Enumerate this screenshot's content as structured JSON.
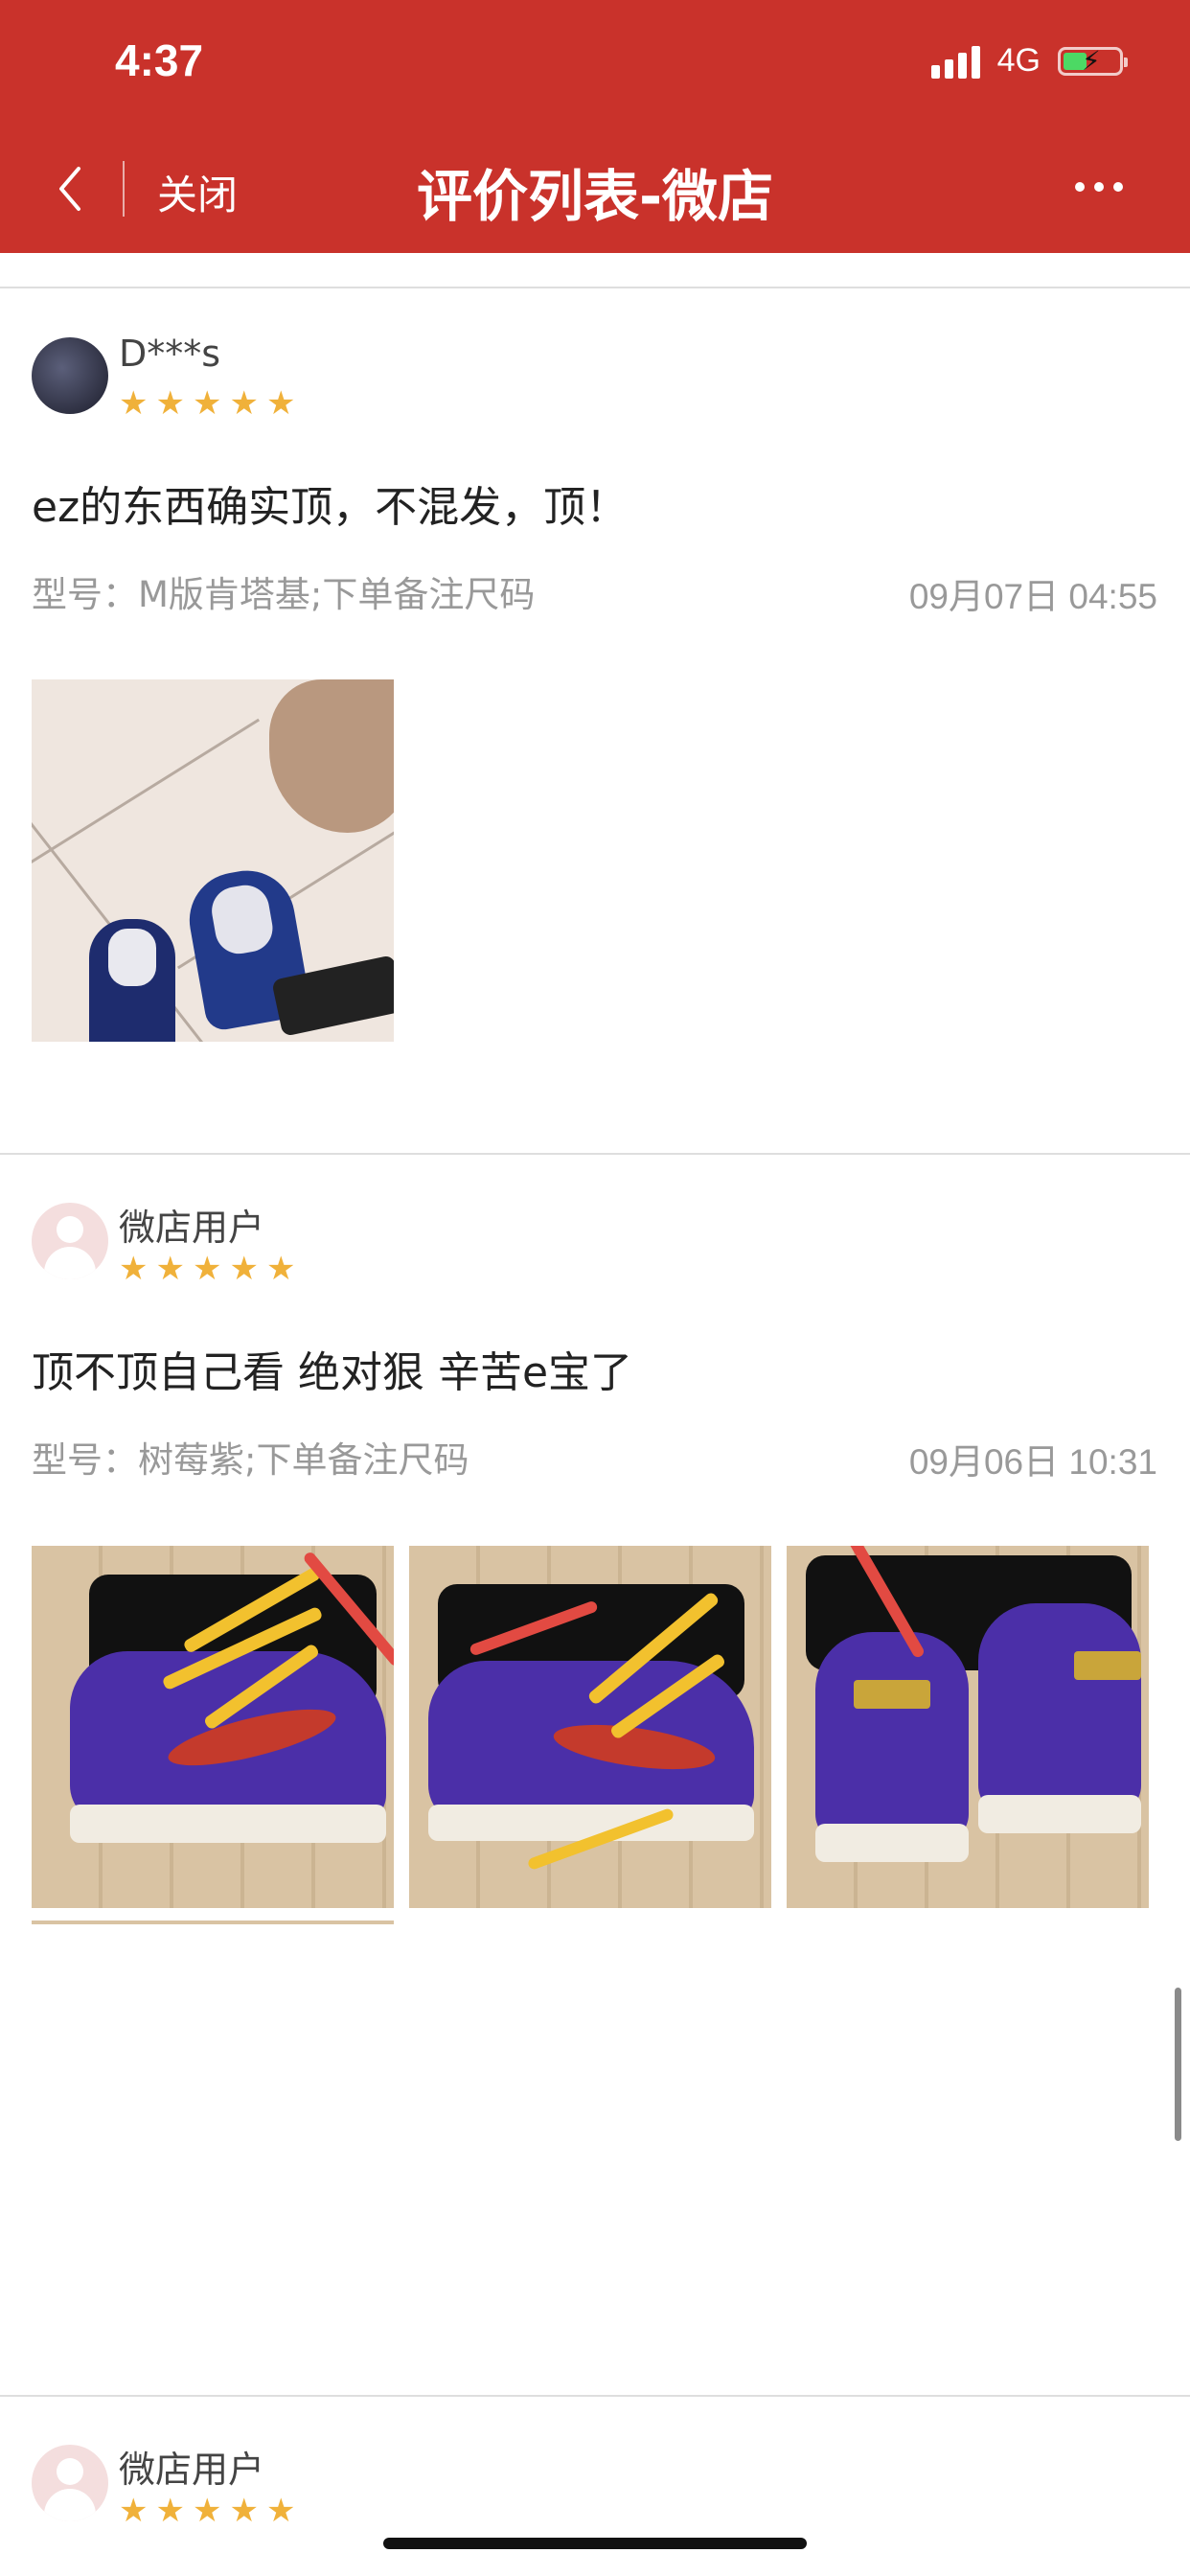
{
  "status_bar": {
    "time": "4:37",
    "network": "4G",
    "battery_icon": "battery-charging-icon"
  },
  "nav": {
    "back_icon": "chevron-left-icon",
    "close_label": "关闭",
    "title": "评价列表-微店",
    "more_icon": "more-dots-icon"
  },
  "reviews": [
    {
      "username": "D***s",
      "rating": 5,
      "content": "ez的东西确实顶，不混发，顶！",
      "model": "型号：M版肯塔基;下单备注尺码",
      "date": "09月07日 04:55",
      "photos": [
        "sneaker-photo"
      ]
    },
    {
      "username": "微店用户",
      "rating": 5,
      "content": "顶不顶自己看 绝对狠 辛苦e宝了",
      "model": "型号：树莓紫;下单备注尺码",
      "date": "09月06日 10:31",
      "photos": [
        "sneaker-photo",
        "sneaker-photo",
        "sneaker-photo"
      ]
    },
    {
      "username": "微店用户",
      "rating": 5
    }
  ],
  "colors": {
    "header_bg": "#c9322b",
    "star": "#f0b13a"
  }
}
